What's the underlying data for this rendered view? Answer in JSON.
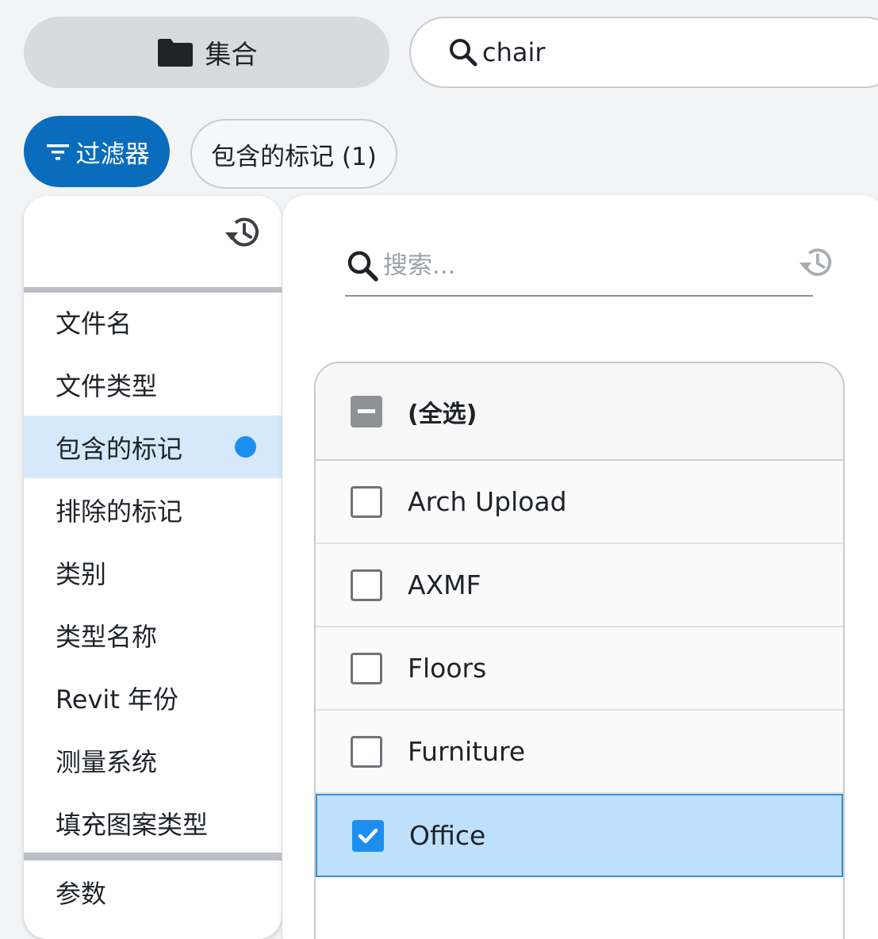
{
  "toolbar": {
    "collections_label": "集合",
    "search_value": "chair"
  },
  "filter_row": {
    "filter_label": "过滤器",
    "active_chip_label": "包含的标记 (1)"
  },
  "left_menu": {
    "items": [
      {
        "label": "文件名"
      },
      {
        "label": "文件类型"
      },
      {
        "label": "包含的标记",
        "active": true
      },
      {
        "label": "排除的标记"
      },
      {
        "label": "类别"
      },
      {
        "label": "类型名称"
      },
      {
        "label": "Revit 年份"
      },
      {
        "label": "测量系统"
      },
      {
        "label": "填充图案类型"
      }
    ],
    "bottom_item": {
      "label": "参数"
    }
  },
  "tag_panel": {
    "search_placeholder": "搜索...",
    "select_all_label": "(全选)",
    "options": [
      {
        "label": "Arch Upload",
        "checked": false
      },
      {
        "label": "AXMF",
        "checked": false
      },
      {
        "label": "Floors",
        "checked": false
      },
      {
        "label": "Furniture",
        "checked": false
      },
      {
        "label": "Office",
        "checked": true
      }
    ]
  },
  "colors": {
    "primary": "#0a6cbd",
    "active_dot": "#1c8ef0",
    "active_bg": "#d5e9fb",
    "selected_row_bg": "#bfe0fa"
  }
}
